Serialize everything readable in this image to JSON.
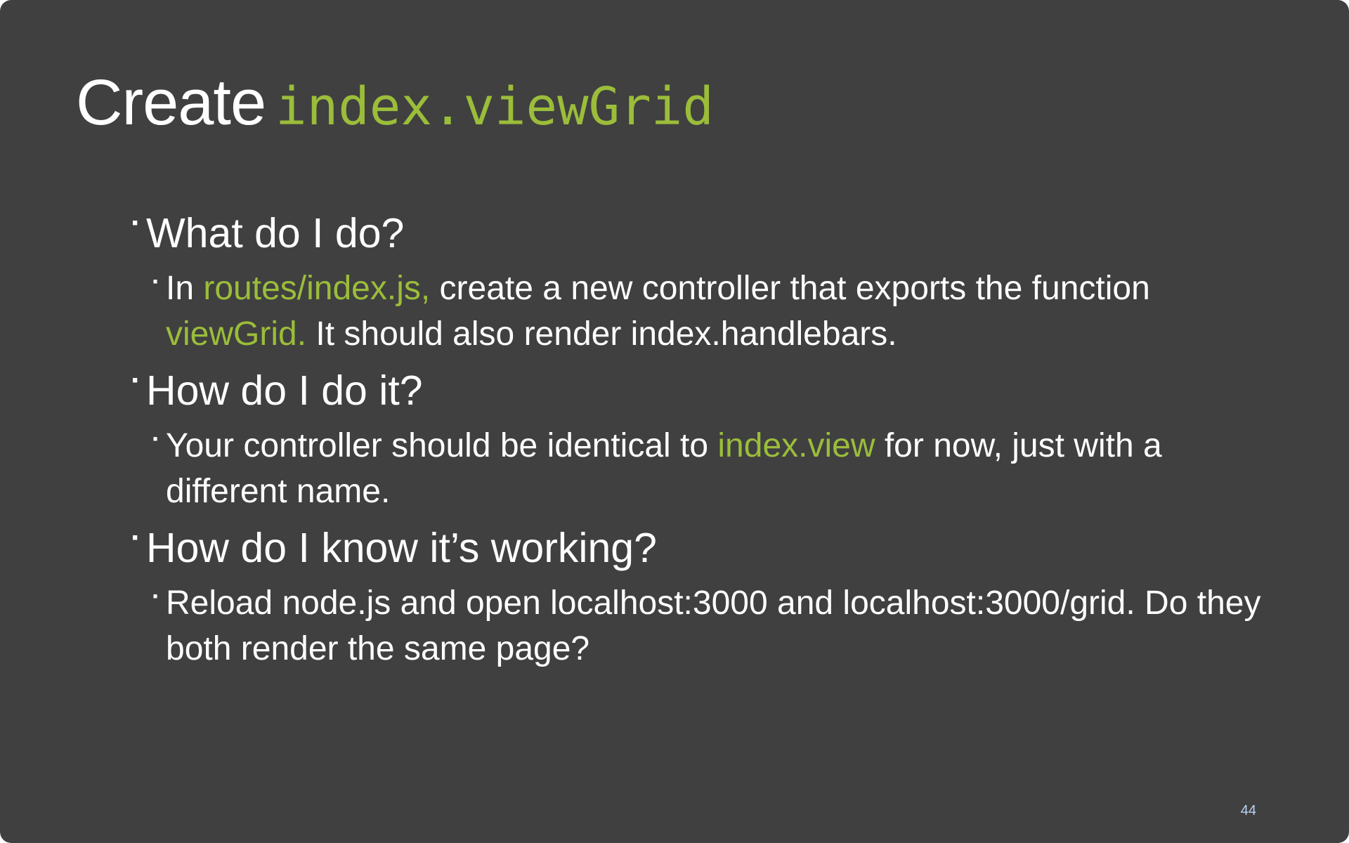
{
  "slide": {
    "title_word": "Create",
    "title_code": "index.viewGrid",
    "page_number": "44"
  },
  "sections": [
    {
      "heading": "What do I do?",
      "detail": {
        "p1": "In ",
        "h1": "routes/index.js,",
        "p2": " create a new controller that exports the function ",
        "h2": "viewGrid.",
        "p3": " It should also render index.handlebars."
      }
    },
    {
      "heading": "How do I do it?",
      "detail": {
        "p1": "Your controller should be identical to ",
        "h1": "index.view",
        "p2": " for now, just with a different name."
      }
    },
    {
      "heading": "How do I know it’s working?",
      "detail": {
        "p1": "Reload node.js and open localhost:3000 and localhost:3000/grid. Do they both render the same page?"
      }
    }
  ],
  "colors": {
    "background": "#404040",
    "text": "#ffffff",
    "accent": "#9bbd3a",
    "page_number": "#b9d4ef"
  }
}
